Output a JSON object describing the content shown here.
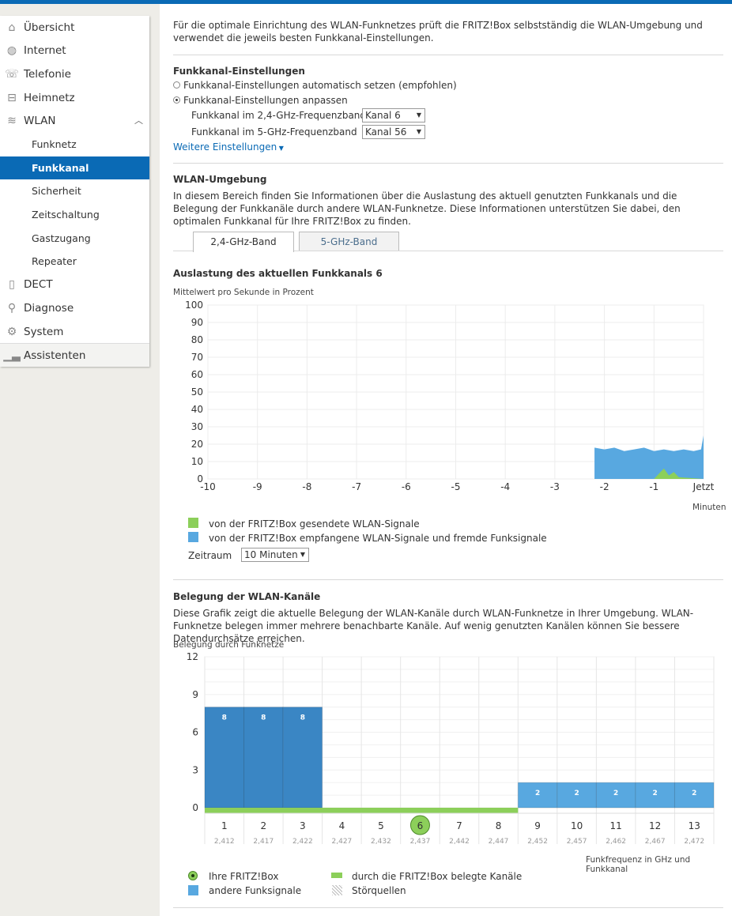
{
  "sidebar": {
    "items": [
      {
        "label": "Übersicht",
        "icon": "home-icon"
      },
      {
        "label": "Internet",
        "icon": "globe-icon"
      },
      {
        "label": "Telefonie",
        "icon": "phone-icon"
      },
      {
        "label": "Heimnetz",
        "icon": "network-icon"
      },
      {
        "label": "WLAN",
        "icon": "wifi-icon"
      },
      {
        "label": "Funknetz"
      },
      {
        "label": "Funkkanal"
      },
      {
        "label": "Sicherheit"
      },
      {
        "label": "Zeitschaltung"
      },
      {
        "label": "Gastzugang"
      },
      {
        "label": "Repeater"
      },
      {
        "label": "DECT",
        "icon": "dect-phone-icon"
      },
      {
        "label": "Diagnose",
        "icon": "magnifier-icon"
      },
      {
        "label": "System",
        "icon": "gear-icon"
      },
      {
        "label": "Assistenten",
        "icon": "bars-icon"
      }
    ]
  },
  "intro": "Für die optimale Einrichtung des WLAN-Funknetzes prüft die FRITZ!Box selbstständig die WLAN-Umgebung und verwendet die jeweils besten Funkkanal-Einstellungen.",
  "settings": {
    "heading": "Funkkanal-Einstellungen",
    "option_auto": "Funkkanal-Einstellungen automatisch setzen (empfohlen)",
    "option_manual": "Funkkanal-Einstellungen anpassen",
    "band24_label": "Funkkanal im 2,4-GHz-Frequenzband",
    "band24_value": "Kanal 6",
    "band5_label": "Funkkanal im 5-GHz-Frequenzband",
    "band5_value": "Kanal 56",
    "more_link": "Weitere Einstellungen"
  },
  "environment": {
    "heading": "WLAN-Umgebung",
    "text": "In diesem Bereich finden Sie Informationen über die Auslastung des aktuell genutzten Funkkanals und die Belegung der Funkkanäle durch andere WLAN-Funknetze. Diese Informationen unterstützen Sie dabei, den optimalen Funkkanal für Ihre FRITZ!Box zu finden.",
    "tabs": [
      "2,4-GHz-Band",
      "5-GHz-Band"
    ]
  },
  "load": {
    "heading": "Auslastung des aktuellen Funkkanals 6",
    "ylabel": "Mittelwert pro Sekunde in Prozent",
    "xlabel": "Minuten",
    "legend_sent": "von der FRITZ!Box gesendete WLAN-Signale",
    "legend_received": "von der FRITZ!Box empfangene WLAN-Signale und fremde Funksignale",
    "period_label": "Zeitraum",
    "period_value": "10 Minuten",
    "colors": {
      "sent": "#8ccf5a",
      "received": "#58a8e0"
    }
  },
  "occupancy": {
    "heading": "Belegung der WLAN-Kanäle",
    "text": "Diese Grafik zeigt die aktuelle Belegung der WLAN-Kanäle durch WLAN-Funknetze in Ihrer Umgebung. WLAN-Funknetze belegen immer mehrere benachbarte Kanäle. Auf wenig genutzten Kanälen können Sie bessere Datendurchsätze erreichen.",
    "ylabel": "Belegung durch Funknetze",
    "xlabel": "Funkfrequenz in GHz und Funkkanal",
    "legend_own": "Ihre FRITZ!Box",
    "legend_other": "andere Funksignale",
    "legend_occupied": "durch die FRITZ!Box belegte Kanäle",
    "legend_interference": "Störquellen",
    "colors": {
      "own_dark": "#3a86c4",
      "other": "#58a8e0",
      "occupied": "#8ccf5a"
    }
  },
  "chart_data": [
    {
      "type": "area",
      "ylabel": "Mittelwert pro Sekunde in Prozent",
      "xlabel": "Minuten",
      "ylim": [
        0,
        100
      ],
      "yticks": [
        0,
        10,
        20,
        30,
        40,
        50,
        60,
        70,
        80,
        90,
        100
      ],
      "xticks": [
        "-10",
        "-9",
        "-8",
        "-7",
        "-6",
        "-5",
        "-4",
        "-3",
        "-2",
        "-1",
        "Jetzt"
      ],
      "xlim": [
        -10,
        0
      ],
      "series": [
        {
          "name": "von der FRITZ!Box empfangene WLAN-Signale und fremde Funksignale",
          "x": [
            -2.2,
            -2.0,
            -1.8,
            -1.6,
            -1.4,
            -1.2,
            -1.0,
            -0.8,
            -0.6,
            -0.4,
            -0.2,
            -0.05,
            0
          ],
          "y": [
            18,
            17,
            18,
            16,
            17,
            18,
            16,
            17,
            16,
            17,
            16,
            17,
            25
          ]
        },
        {
          "name": "von der FRITZ!Box gesendete WLAN-Signale",
          "x": [
            -2.2,
            -1.0,
            -0.9,
            -0.8,
            -0.7,
            -0.6,
            -0.5,
            0
          ],
          "y": [
            0,
            0,
            3,
            6,
            2,
            4,
            1,
            0
          ]
        }
      ]
    },
    {
      "type": "bar",
      "ylabel": "Belegung durch Funknetze",
      "xlabel": "Funkfrequenz in GHz und Funkkanal",
      "ylim": [
        0,
        12
      ],
      "yticks": [
        0,
        3,
        6,
        9,
        12
      ],
      "categories": [
        "1",
        "2",
        "3",
        "4",
        "5",
        "6",
        "7",
        "8",
        "9",
        "10",
        "11",
        "12",
        "13"
      ],
      "frequencies": [
        "2,412",
        "2,417",
        "2,422",
        "2,427",
        "2,432",
        "2,437",
        "2,442",
        "2,447",
        "2,452",
        "2,457",
        "2,462",
        "2,467",
        "2,472"
      ],
      "values": [
        8,
        8,
        8,
        0,
        0,
        0,
        0,
        0,
        2,
        2,
        2,
        2,
        2
      ],
      "own_channel": "6",
      "occupied_channels": [
        "1",
        "2",
        "3",
        "4",
        "5",
        "6",
        "7",
        "8"
      ]
    }
  ]
}
